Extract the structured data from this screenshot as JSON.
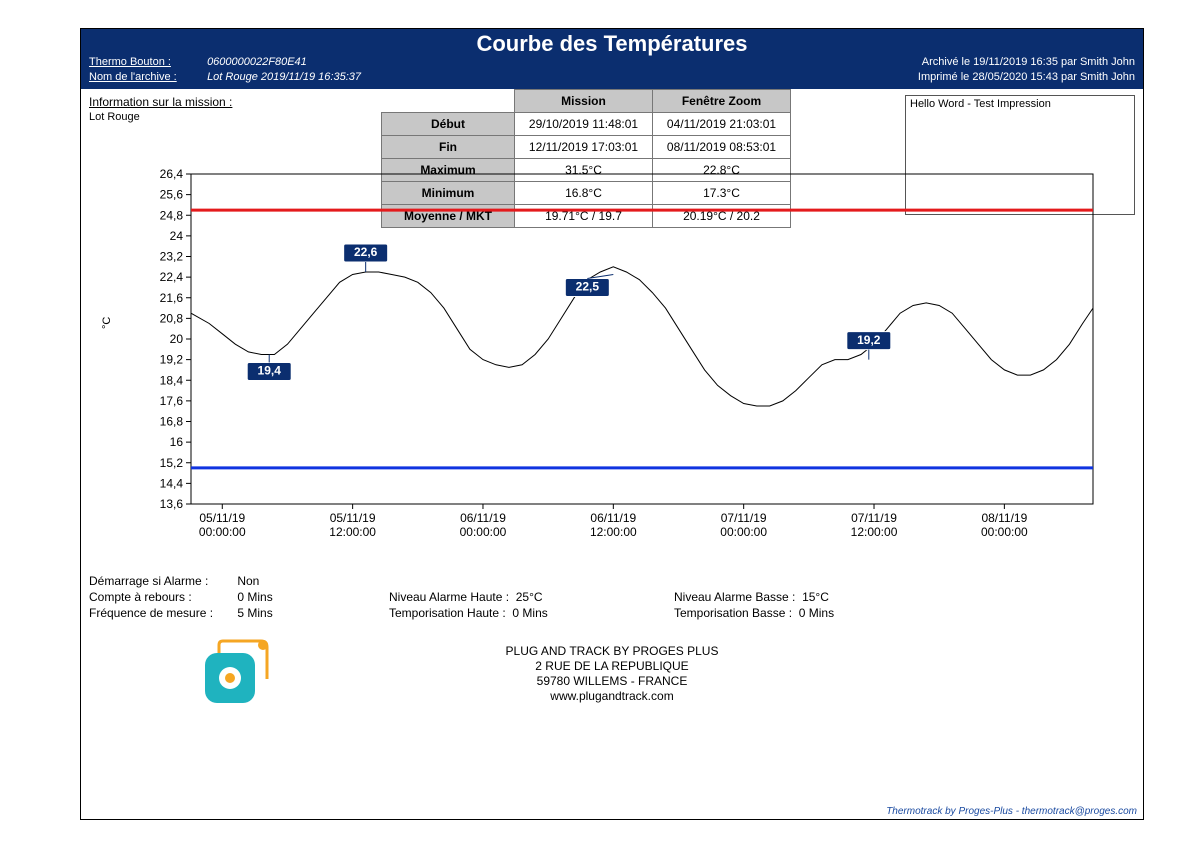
{
  "header": {
    "title": "Courbe des Températures",
    "thermo_label": "Thermo Bouton :",
    "thermo_value": "0600000022F80E41",
    "archive_label": "Nom de l'archive :",
    "archive_value": "Lot Rouge 2019/11/19 16:35:37",
    "archived": "Archivé le 19/11/2019 16:35 par Smith John",
    "printed": "Imprimé le 28/05/2020 15:43 par Smith John"
  },
  "mission_info": {
    "title": "Information sur la mission :",
    "name": "Lot Rouge"
  },
  "summary": {
    "col_mission": "Mission",
    "col_zoom": "Fenêtre Zoom",
    "rows": [
      {
        "label": "Début",
        "mission": "29/10/2019 11:48:01",
        "zoom": "04/11/2019 21:03:01"
      },
      {
        "label": "Fin",
        "mission": "12/11/2019 17:03:01",
        "zoom": "08/11/2019 08:53:01"
      },
      {
        "label": "Maximum",
        "mission": "31.5°C",
        "zoom": "22.8°C"
      },
      {
        "label": "Minimum",
        "mission": "16.8°C",
        "zoom": "17.3°C"
      },
      {
        "label": "Moyenne / MKT",
        "mission": "19.71°C / 19.7",
        "zoom": "20.19°C / 20.2"
      }
    ]
  },
  "note": "Hello Word - Test Impression",
  "chart_data": {
    "type": "line",
    "ylabel": "°C",
    "ylim": [
      13.6,
      26.4
    ],
    "y_ticks": [
      26.4,
      25.6,
      24.8,
      24.0,
      23.2,
      22.4,
      21.6,
      20.8,
      20.0,
      19.2,
      18.4,
      17.6,
      16.8,
      16.0,
      15.2,
      14.4,
      13.6
    ],
    "y_tick_labels": [
      "26,4",
      "25,6",
      "24,8",
      "24",
      "23,2",
      "22,4",
      "21,6",
      "20,8",
      "20",
      "19,2",
      "18,4",
      "17,6",
      "16,8",
      "16",
      "15,2",
      "14,4",
      "13,6"
    ],
    "x_ticks": [
      0,
      0.5,
      1,
      1.5,
      2,
      2.5,
      3
    ],
    "x_tick_labels_line1": [
      "05/11/19",
      "05/11/19",
      "06/11/19",
      "06/11/19",
      "07/11/19",
      "07/11/19",
      "08/11/19"
    ],
    "x_tick_labels_line2": [
      "00:00:00",
      "12:00:00",
      "00:00:00",
      "12:00:00",
      "00:00:00",
      "12:00:00",
      "00:00:00"
    ],
    "alarm_high": 25.0,
    "alarm_low": 15.0,
    "series": [
      {
        "name": "temperature",
        "x": [
          -0.12,
          -0.05,
          0.0,
          0.05,
          0.1,
          0.15,
          0.2,
          0.25,
          0.3,
          0.35,
          0.4,
          0.45,
          0.5,
          0.55,
          0.6,
          0.65,
          0.7,
          0.75,
          0.8,
          0.85,
          0.9,
          0.95,
          1.0,
          1.05,
          1.1,
          1.15,
          1.2,
          1.25,
          1.3,
          1.35,
          1.4,
          1.45,
          1.5,
          1.55,
          1.6,
          1.65,
          1.7,
          1.75,
          1.8,
          1.85,
          1.9,
          1.95,
          2.0,
          2.05,
          2.1,
          2.15,
          2.2,
          2.25,
          2.3,
          2.35,
          2.4,
          2.45,
          2.5,
          2.55,
          2.6,
          2.65,
          2.7,
          2.75,
          2.8,
          2.85,
          2.9,
          2.95,
          3.0,
          3.05,
          3.1,
          3.15,
          3.2,
          3.25,
          3.3,
          3.34
        ],
        "y": [
          21.0,
          20.6,
          20.2,
          19.8,
          19.5,
          19.4,
          19.4,
          19.8,
          20.4,
          21.0,
          21.6,
          22.2,
          22.5,
          22.6,
          22.6,
          22.5,
          22.4,
          22.2,
          21.8,
          21.2,
          20.4,
          19.6,
          19.2,
          19.0,
          18.9,
          19.0,
          19.4,
          20.0,
          20.8,
          21.6,
          22.3,
          22.6,
          22.8,
          22.6,
          22.3,
          21.8,
          21.2,
          20.4,
          19.6,
          18.8,
          18.2,
          17.8,
          17.5,
          17.4,
          17.4,
          17.6,
          18.0,
          18.5,
          19.0,
          19.2,
          19.2,
          19.4,
          19.8,
          20.4,
          21.0,
          21.3,
          21.4,
          21.3,
          21.0,
          20.4,
          19.8,
          19.2,
          18.8,
          18.6,
          18.6,
          18.8,
          19.2,
          19.8,
          20.6,
          21.2
        ]
      }
    ],
    "annotations": [
      {
        "x_day": 0.18,
        "y": 19.4,
        "label": "19,4",
        "pos": "below"
      },
      {
        "x_day": 0.55,
        "y": 22.6,
        "label": "22,6",
        "pos": "above"
      },
      {
        "x_day": 1.5,
        "y": 22.5,
        "label": "22,5",
        "pos": "below-left"
      },
      {
        "x_day": 2.48,
        "y": 19.2,
        "label": "19,2",
        "pos": "above"
      }
    ]
  },
  "footer": {
    "start_alarm_lbl": "Démarrage si Alarme :",
    "start_alarm_val": "Non",
    "countdown_lbl": "Compte à rebours :",
    "countdown_val": "0 Mins",
    "freq_lbl": "Fréquence de mesure :",
    "freq_val": "5 Mins",
    "alarm_high_lbl": "Niveau Alarme Haute :",
    "alarm_high_val": "25°C",
    "tempo_high_lbl": "Temporisation Haute :",
    "tempo_high_val": "0 Mins",
    "alarm_low_lbl": "Niveau Alarme Basse :",
    "alarm_low_val": "15°C",
    "tempo_low_lbl": "Temporisation Basse :",
    "tempo_low_val": "0 Mins"
  },
  "company": {
    "line1": "PLUG AND TRACK BY PROGES PLUS",
    "line2": "2 RUE DE LA REPUBLIQUE",
    "line3": "59780 WILLEMS - FRANCE",
    "line4": "www.plugandtrack.com"
  },
  "credit": "Thermotrack by Proges-Plus - thermotrack@proges.com"
}
